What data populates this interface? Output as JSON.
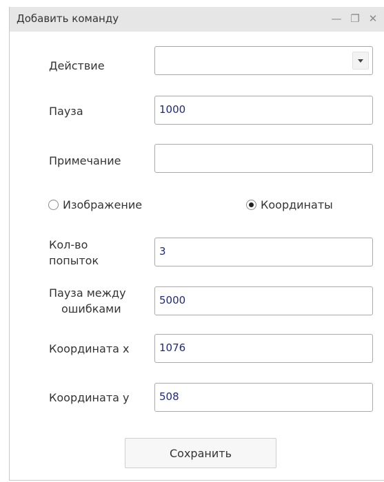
{
  "window": {
    "title": "Добавить команду",
    "minimize_glyph": "—",
    "restore_glyph": "❐",
    "close_glyph": "✕"
  },
  "form": {
    "action_label": "Действие",
    "action_value": "",
    "pause_label": "Пауза",
    "pause_value": "1000",
    "note_label": "Примечание",
    "note_value": "",
    "mode_image_label": "Изображение",
    "mode_coords_label": "Координаты",
    "mode_selected": "coords",
    "attempts_label_line1": "Кол-во",
    "attempts_label_line2": "попыток",
    "attempts_value": "3",
    "error_pause_label_line1": "Пауза между",
    "error_pause_label_line2": "ошибками",
    "error_pause_value": "5000",
    "coord_x_label": "Координата x",
    "coord_x_value": "1076",
    "coord_y_label": "Координата y",
    "coord_y_value": "508",
    "save_label": "Сохранить"
  },
  "colors": {
    "titlebar_bg": "#e6e6e6",
    "input_text": "#1f2a7a",
    "border": "#a9a9a9"
  }
}
